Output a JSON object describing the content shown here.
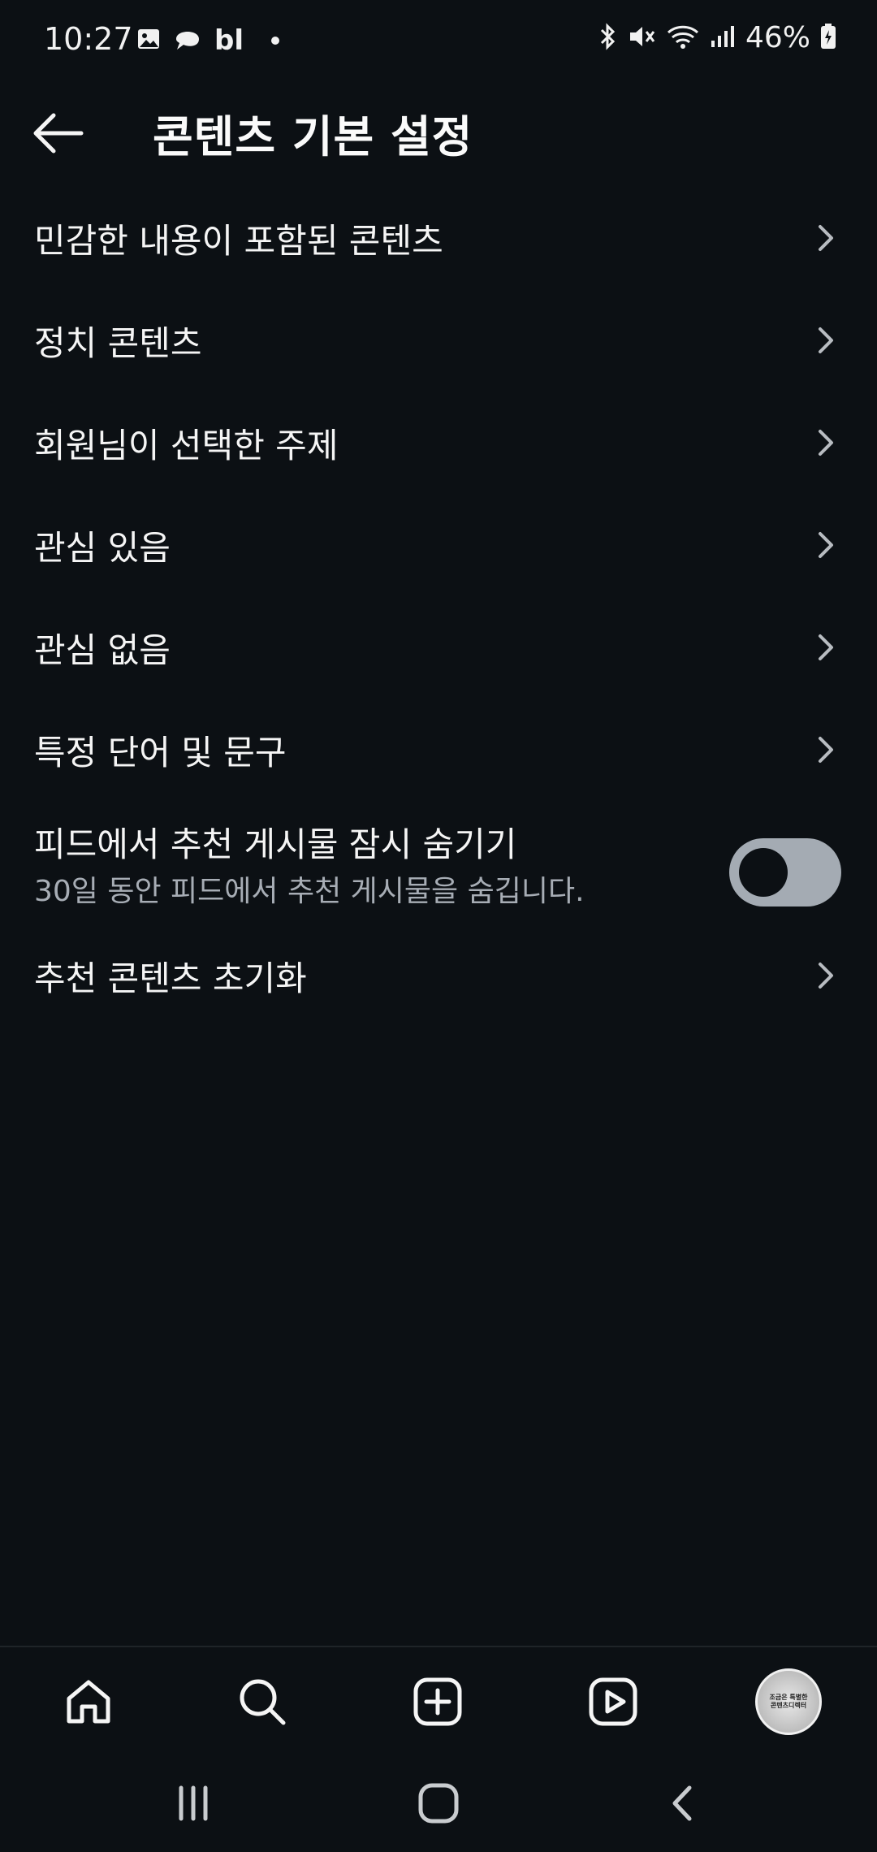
{
  "status_bar": {
    "time": "10:27",
    "app_text": "bl",
    "battery": "46%",
    "icons": [
      "image-icon",
      "thread-icon",
      "bluetooth-icon",
      "mute-icon",
      "wifi-icon",
      "signal-icon",
      "battery-icon"
    ]
  },
  "header": {
    "title": "콘텐츠 기본 설정",
    "back_icon": "arrow-left-icon"
  },
  "list": {
    "items": [
      {
        "label": "민감한 내용이 포함된 콘텐츠"
      },
      {
        "label": "정치 콘텐츠"
      },
      {
        "label": "회원님이 선택한 주제"
      },
      {
        "label": "관심 있음"
      },
      {
        "label": "관심 없음"
      },
      {
        "label": "특정 단어 및 문구"
      }
    ],
    "toggle_item": {
      "title": "피드에서 추천 게시물 잠시 숨기기",
      "subtitle": "30일 동안 피드에서 추천 게시물을 숨깁니다.",
      "state": "off"
    },
    "last_item": {
      "label": "추천 콘텐츠 초기화"
    }
  },
  "bottom_nav": {
    "items": [
      "home-icon",
      "search-icon",
      "create-icon",
      "reels-icon",
      "profile-avatar"
    ],
    "avatar_text_line1": "조금은 특별한",
    "avatar_text_line2": "콘텐츠디렉터"
  },
  "system_nav": {
    "items": [
      "recent-apps-icon",
      "home-button-icon",
      "back-icon"
    ]
  },
  "colors": {
    "background": "#0c1014",
    "text": "#f5f5f5",
    "subtext": "#a7adb5",
    "toggle_track": "#a4abb3"
  }
}
